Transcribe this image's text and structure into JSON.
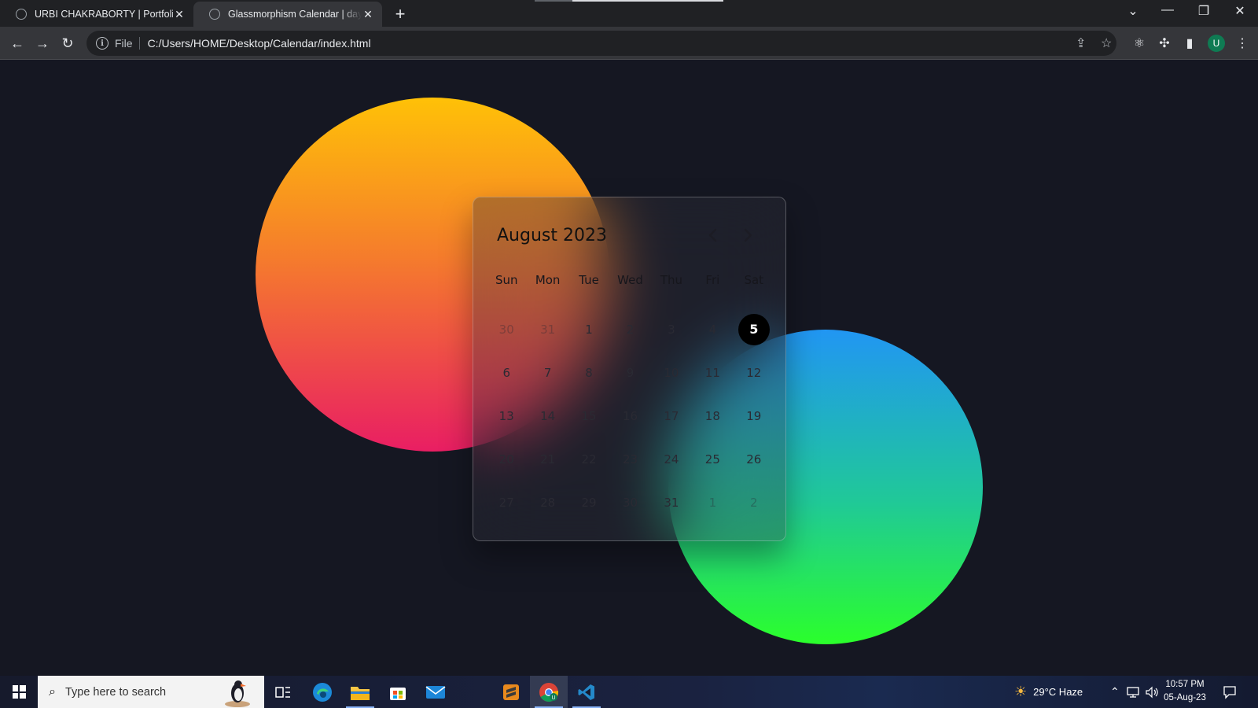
{
  "browser": {
    "tabs": [
      {
        "title": "URBI CHAKRABORTY | Portfolio",
        "active": false
      },
      {
        "title": "Glassmorphism Calendar | dayCalendar",
        "active": true
      }
    ],
    "new_tab_label": "+",
    "address": {
      "scheme_label": "File",
      "url": "C:/Users/HOME/Desktop/Calendar/index.html"
    },
    "profile_initial": "U"
  },
  "calendar": {
    "title": "August 2023",
    "prev_label": "‹",
    "next_label": "›",
    "weekdays": [
      "Sun",
      "Mon",
      "Tue",
      "Wed",
      "Thu",
      "Fri",
      "Sat"
    ],
    "days": [
      {
        "label": "30",
        "muted": true
      },
      {
        "label": "31",
        "muted": true
      },
      {
        "label": "1"
      },
      {
        "label": "2"
      },
      {
        "label": "3"
      },
      {
        "label": "4"
      },
      {
        "label": "5",
        "today": true
      },
      {
        "label": "6"
      },
      {
        "label": "7"
      },
      {
        "label": "8"
      },
      {
        "label": "9"
      },
      {
        "label": "10"
      },
      {
        "label": "11"
      },
      {
        "label": "12"
      },
      {
        "label": "13"
      },
      {
        "label": "14"
      },
      {
        "label": "15"
      },
      {
        "label": "16"
      },
      {
        "label": "17"
      },
      {
        "label": "18"
      },
      {
        "label": "19"
      },
      {
        "label": "20"
      },
      {
        "label": "21"
      },
      {
        "label": "22"
      },
      {
        "label": "23"
      },
      {
        "label": "24"
      },
      {
        "label": "25"
      },
      {
        "label": "26"
      },
      {
        "label": "27"
      },
      {
        "label": "28"
      },
      {
        "label": "29"
      },
      {
        "label": "30"
      },
      {
        "label": "31"
      },
      {
        "label": "1",
        "muted": true
      },
      {
        "label": "2",
        "muted": true
      }
    ]
  },
  "taskbar": {
    "search_placeholder": "Type here to search",
    "weather": "29°C  Haze",
    "time": "10:57 PM",
    "date": "05-Aug-23"
  },
  "colors": {
    "page_bg": "#151722",
    "orb_warm": [
      "#ffc107",
      "#f57c2c",
      "#e91e63"
    ],
    "orb_cool": [
      "#2196f3",
      "#20c997",
      "#2bff2b"
    ],
    "today_bg": "#000000"
  }
}
